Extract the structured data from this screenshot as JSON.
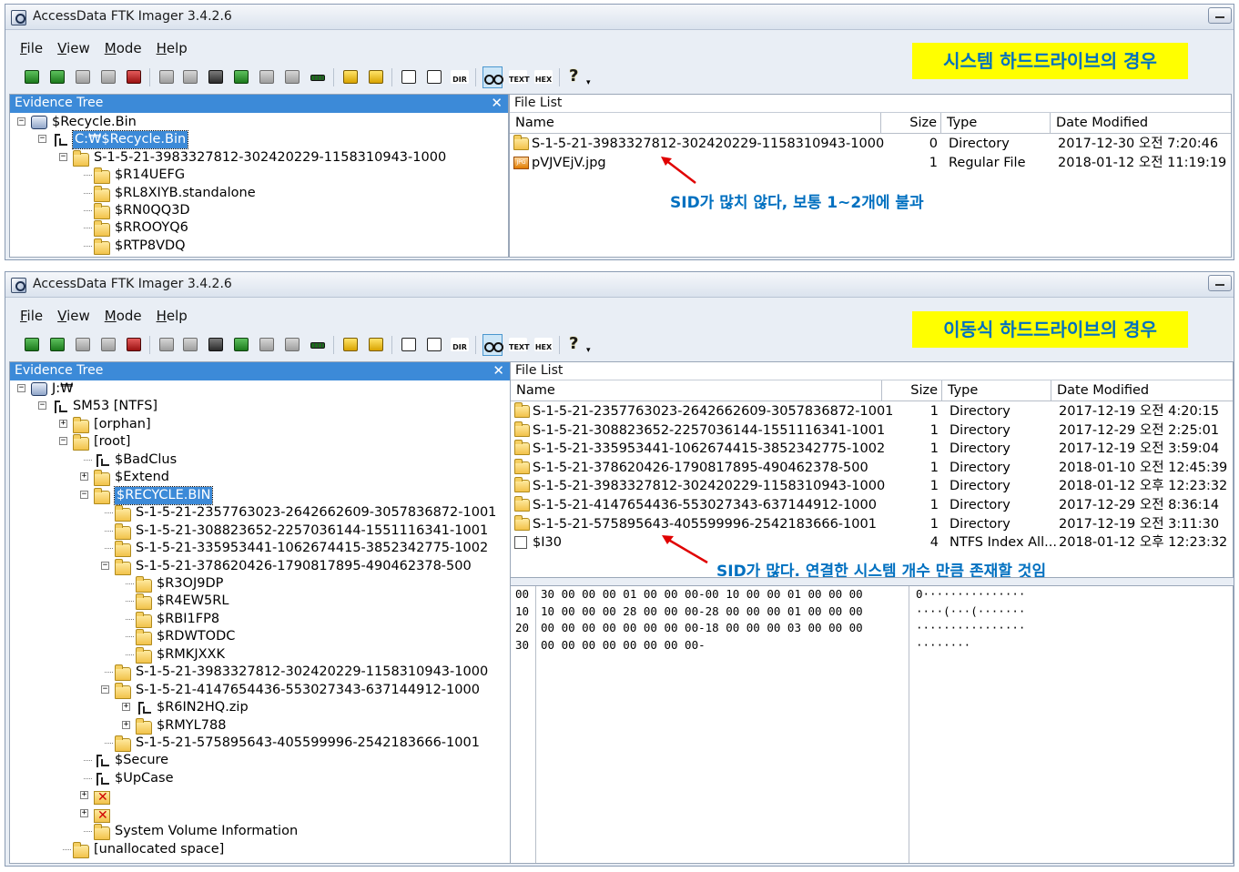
{
  "window1": {
    "title": "AccessData FTK Imager 3.4.2.6",
    "menu": [
      "File",
      "View",
      "Mode",
      "Help"
    ],
    "note": "시스템 하드드라이브의 경우",
    "evidence_tree_title": "Evidence Tree",
    "file_list_title": "File List",
    "tree": [
      {
        "label": "$Recycle.Bin",
        "level": 0,
        "icon": "drive-icon",
        "expander": "-"
      },
      {
        "label": "C:₩$Recycle.Bin",
        "level": 1,
        "icon": "filesystem-icon",
        "expander": "-",
        "selected": true
      },
      {
        "label": "S-1-5-21-3983327812-302420229-1158310943-1000",
        "level": 2,
        "icon": "folder-icon",
        "expander": "-"
      },
      {
        "label": "$R14UEFG",
        "level": 3,
        "icon": "folder-icon",
        "expander": ""
      },
      {
        "label": "$RL8XIYB.standalone",
        "level": 3,
        "icon": "folder-icon",
        "expander": ""
      },
      {
        "label": "$RN0QQ3D",
        "level": 3,
        "icon": "folder-icon",
        "expander": ""
      },
      {
        "label": "$RROOYQ6",
        "level": 3,
        "icon": "folder-icon",
        "expander": ""
      },
      {
        "label": "$RTP8VDQ",
        "level": 3,
        "icon": "folder-icon",
        "expander": ""
      }
    ],
    "columns": {
      "name": "Name",
      "size": "Size",
      "type": "Type",
      "date": "Date Modified"
    },
    "rows": [
      {
        "name": "S-1-5-21-3983327812-302420229-1158310943-1000",
        "size": "0",
        "type": "Directory",
        "date": "2017-12-30 오전 7:20:46",
        "icon": "folder-icon"
      },
      {
        "name": "pVJVEjV.jpg",
        "size": "1",
        "type": "Regular File",
        "date": "2018-01-12 오전 11:19:19",
        "icon": "jpg-file-icon"
      }
    ],
    "annotation": "SID가 많치 않다, 보통 1~2개에 불과"
  },
  "window2": {
    "title": "AccessData FTK Imager 3.4.2.6",
    "menu": [
      "File",
      "View",
      "Mode",
      "Help"
    ],
    "note": "이동식 하드드라이브의 경우",
    "evidence_tree_title": "Evidence Tree",
    "file_list_title": "File List",
    "tree": [
      {
        "label": "J:₩",
        "level": 0,
        "icon": "drive-icon",
        "expander": "-"
      },
      {
        "label": "SM53 [NTFS]",
        "level": 1,
        "icon": "filesystem-icon",
        "expander": "-"
      },
      {
        "label": "[orphan]",
        "level": 2,
        "icon": "folder-icon",
        "expander": "+"
      },
      {
        "label": "[root]",
        "level": 2,
        "icon": "folder-icon",
        "expander": "-"
      },
      {
        "label": "$BadClus",
        "level": 3,
        "icon": "filesystem-icon",
        "expander": ""
      },
      {
        "label": "$Extend",
        "level": 3,
        "icon": "folder-icon",
        "expander": "+"
      },
      {
        "label": "$RECYCLE.BIN",
        "level": 3,
        "icon": "folder-icon",
        "expander": "-",
        "selected": true
      },
      {
        "label": "S-1-5-21-2357763023-2642662609-3057836872-1001",
        "level": 4,
        "icon": "folder-icon",
        "expander": ""
      },
      {
        "label": "S-1-5-21-308823652-2257036144-1551116341-1001",
        "level": 4,
        "icon": "folder-icon",
        "expander": ""
      },
      {
        "label": "S-1-5-21-335953441-1062674415-3852342775-1002",
        "level": 4,
        "icon": "folder-icon",
        "expander": ""
      },
      {
        "label": "S-1-5-21-378620426-1790817895-490462378-500",
        "level": 4,
        "icon": "folder-icon",
        "expander": "-"
      },
      {
        "label": "$R3OJ9DP",
        "level": 5,
        "icon": "folder-icon",
        "expander": ""
      },
      {
        "label": "$R4EW5RL",
        "level": 5,
        "icon": "folder-icon",
        "expander": ""
      },
      {
        "label": "$RBI1FP8",
        "level": 5,
        "icon": "folder-icon",
        "expander": ""
      },
      {
        "label": "$RDWTODC",
        "level": 5,
        "icon": "folder-icon",
        "expander": ""
      },
      {
        "label": "$RMKJXXK",
        "level": 5,
        "icon": "folder-icon",
        "expander": ""
      },
      {
        "label": "S-1-5-21-3983327812-302420229-1158310943-1000",
        "level": 4,
        "icon": "folder-icon",
        "expander": ""
      },
      {
        "label": "S-1-5-21-4147654436-553027343-637144912-1000",
        "level": 4,
        "icon": "folder-icon",
        "expander": "-"
      },
      {
        "label": "$R6IN2HQ.zip",
        "level": 5,
        "icon": "filesystem-icon",
        "expander": "+"
      },
      {
        "label": "$RMYL788",
        "level": 5,
        "icon": "folder-icon",
        "expander": "+"
      },
      {
        "label": "S-1-5-21-575895643-405599996-2542183666-1001",
        "level": 4,
        "icon": "folder-icon",
        "expander": ""
      },
      {
        "label": "$Secure",
        "level": 3,
        "icon": "filesystem-icon",
        "expander": ""
      },
      {
        "label": "$UpCase",
        "level": 3,
        "icon": "filesystem-icon",
        "expander": ""
      },
      {
        "label": "",
        "level": 3,
        "icon": "deleted-folder-icon",
        "expander": "+"
      },
      {
        "label": "",
        "level": 3,
        "icon": "deleted-folder-icon",
        "expander": "+"
      },
      {
        "label": "System Volume Information",
        "level": 3,
        "icon": "folder-icon",
        "expander": ""
      },
      {
        "label": "[unallocated space]",
        "level": 2,
        "icon": "folder-icon",
        "expander": ""
      }
    ],
    "columns": {
      "name": "Name",
      "size": "Size",
      "type": "Type",
      "date": "Date Modified"
    },
    "rows": [
      {
        "name": "S-1-5-21-2357763023-2642662609-3057836872-1001",
        "size": "1",
        "type": "Directory",
        "date": "2017-12-19 오전 4:20:15",
        "icon": "folder-icon"
      },
      {
        "name": "S-1-5-21-308823652-2257036144-1551116341-1001",
        "size": "1",
        "type": "Directory",
        "date": "2017-12-29 오전 2:25:01",
        "icon": "folder-icon"
      },
      {
        "name": "S-1-5-21-335953441-1062674415-3852342775-1002",
        "size": "1",
        "type": "Directory",
        "date": "2017-12-19 오전 3:59:04",
        "icon": "folder-icon"
      },
      {
        "name": "S-1-5-21-378620426-1790817895-490462378-500",
        "size": "1",
        "type": "Directory",
        "date": "2018-01-10 오전 12:45:39",
        "icon": "folder-icon"
      },
      {
        "name": "S-1-5-21-3983327812-302420229-1158310943-1000",
        "size": "1",
        "type": "Directory",
        "date": "2018-01-12 오후 12:23:32",
        "icon": "folder-icon"
      },
      {
        "name": "S-1-5-21-4147654436-553027343-637144912-1000",
        "size": "1",
        "type": "Directory",
        "date": "2017-12-29 오전 8:36:14",
        "icon": "folder-icon"
      },
      {
        "name": "S-1-5-21-575895643-405599996-2542183666-1001",
        "size": "1",
        "type": "Directory",
        "date": "2017-12-19 오전 3:11:30",
        "icon": "folder-icon"
      },
      {
        "name": "$I30",
        "size": "4",
        "type": "NTFS Index All...",
        "date": "2018-01-12 오후 12:23:32",
        "icon": "blank-file-icon"
      }
    ],
    "annotation": "SID가 많다. 연결한 시스템 개수 만큼 존재할 것임",
    "hex": {
      "offsets": [
        "00",
        "10",
        "20",
        "30"
      ],
      "bytes": [
        "30 00 00 00 01 00 00 00-00 10 00 00 01 00 00 00",
        "10 00 00 00 28 00 00 00-28 00 00 00 01 00 00 00",
        "00 00 00 00 00 00 00 00-18 00 00 00 03 00 00 00",
        "00 00 00 00 00 00 00 00-"
      ],
      "ascii": [
        "0···············",
        "····(···(·······",
        "················",
        "········"
      ]
    }
  },
  "toolbar_icons": [
    "add-evidence-icon",
    "add-all-evidence-icon",
    "image-mounting-icon",
    "unmount-icon",
    "remove-evidence-icon",
    "create-disk-image-icon",
    "export-disk-image-icon",
    "export-files-icon",
    "export-file-hash-icon",
    "add-to-custom-content-icon",
    "create-custom-content-icon",
    "capture-memory-icon",
    "obtain-protected-files-icon",
    "detect-encryption-icon",
    "new-document-icon",
    "export-directory-listing-icon",
    "directory-icon",
    "auto-view-icon",
    "text-view-icon",
    "hex-view-icon",
    "help-icon"
  ],
  "toolbar_text": {
    "text": "TEXT",
    "hex": "HEX",
    "dir": "DIR",
    "help": "?",
    "dropdown": "▾"
  }
}
